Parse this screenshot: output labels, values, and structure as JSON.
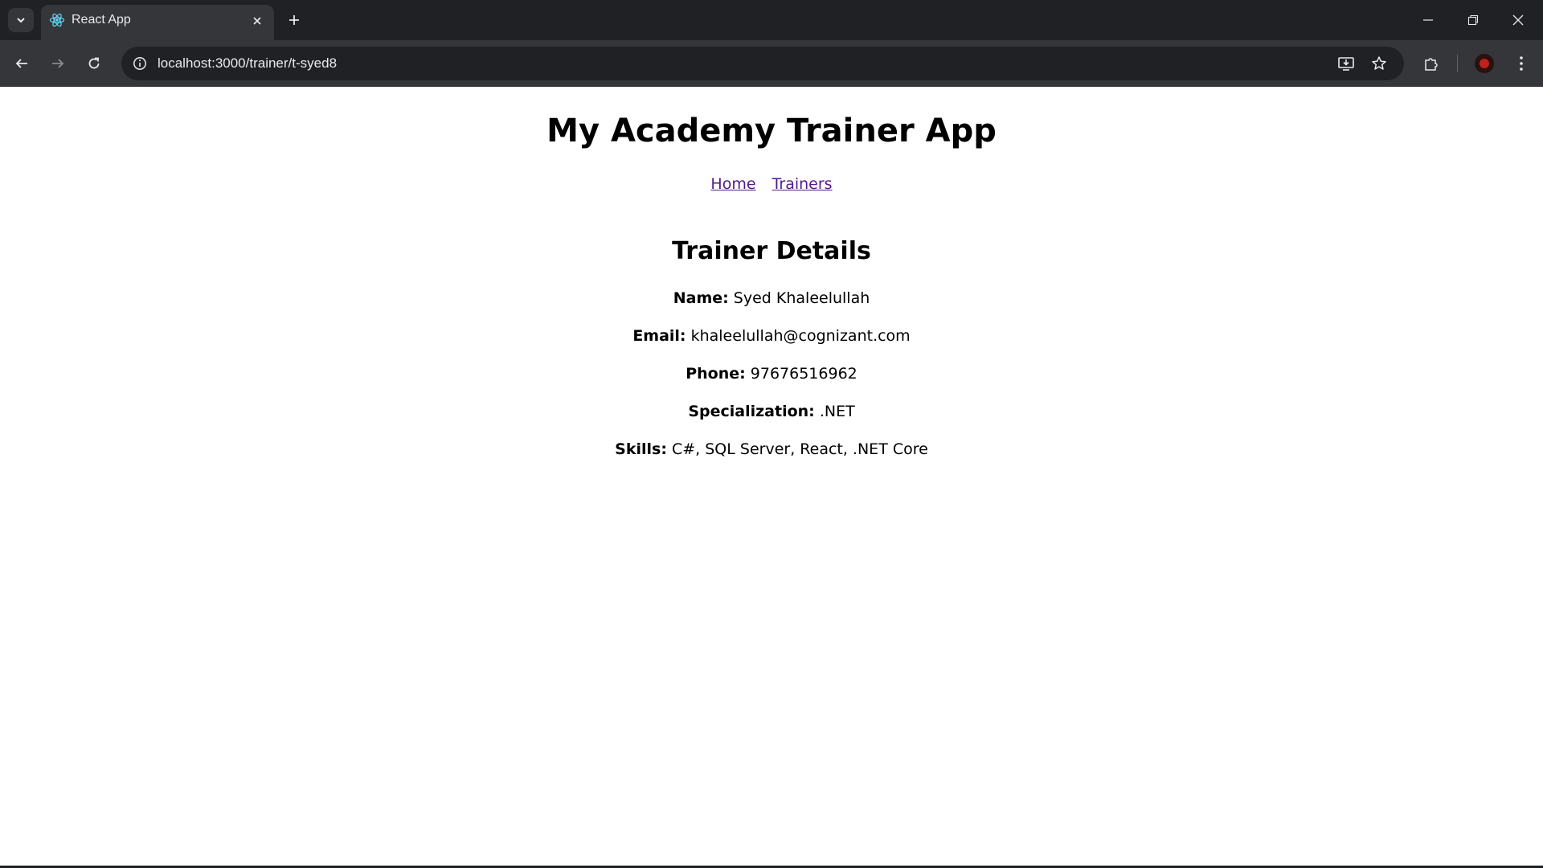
{
  "browser": {
    "tab": {
      "title": "React App",
      "favicon": "react-icon"
    },
    "address": {
      "url": "localhost:3000/trainer/t-syed8"
    },
    "icons": {
      "tab_search": "chevron-down-icon",
      "tab_close": "close-icon",
      "new_tab": "plus-icon",
      "back": "back-arrow-icon",
      "forward": "forward-arrow-icon",
      "reload": "reload-icon",
      "site_info": "info-icon",
      "install": "install-app-icon",
      "bookmark": "star-icon",
      "extensions": "puzzle-icon",
      "profile": "avatar",
      "menu": "kebab-menu-icon",
      "minimize": "minimize-icon",
      "restore": "restore-icon",
      "close_window": "close-icon"
    }
  },
  "page": {
    "app_title": "My Academy Trainer App",
    "nav": [
      {
        "label": "Home"
      },
      {
        "label": "Trainers"
      }
    ],
    "section_title": "Trainer Details",
    "details": [
      {
        "label": "Name:",
        "value": "Syed Khaleelullah"
      },
      {
        "label": "Email:",
        "value": "khaleelullah@cognizant.com"
      },
      {
        "label": "Phone:",
        "value": "97676516962"
      },
      {
        "label": "Specialization:",
        "value": ".NET"
      },
      {
        "label": "Skills:",
        "value": "C#, SQL Server, React, .NET Core"
      }
    ]
  },
  "colors": {
    "chrome_dark": "#202124",
    "chrome_toolbar": "#35363a",
    "link_visited": "#551a8b"
  }
}
